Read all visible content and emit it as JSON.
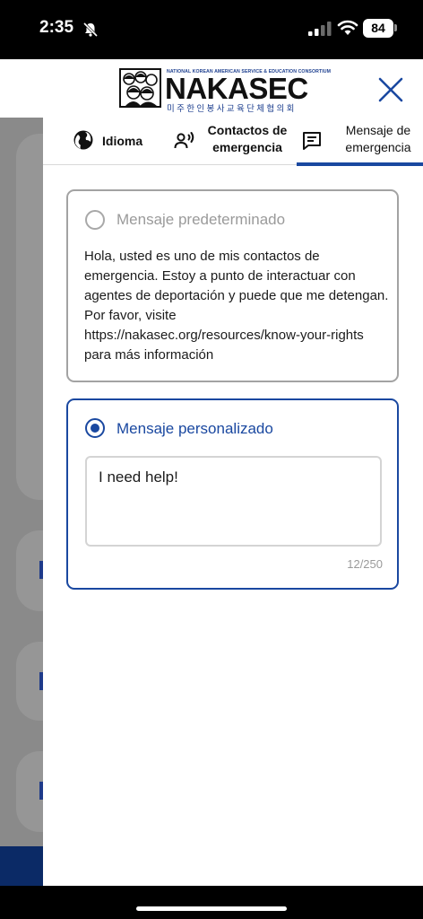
{
  "status_bar": {
    "time": "2:35",
    "battery": "84",
    "icons": [
      "bell-slash-icon",
      "cellular-signal-icon",
      "wifi-icon",
      "battery-icon"
    ]
  },
  "header": {
    "logo": {
      "tagline": "NATIONAL KOREAN AMERICAN SERVICE & EDUCATION CONSORTIUM",
      "name": "NAKASEC",
      "korean": "미주한인봉사교육단체협의회"
    },
    "close_icon": "close-icon"
  },
  "tabs": [
    {
      "label": "Idioma",
      "icon": "globe-icon",
      "active": false
    },
    {
      "label": "Contactos de emergencia",
      "icon": "person-voice-icon",
      "active": false
    },
    {
      "label": "Mensaje de emergencia",
      "icon": "message-icon",
      "active": true
    }
  ],
  "options": {
    "default": {
      "title": "Mensaje predeterminado",
      "selected": false,
      "text": "Hola, usted es uno de mis contactos de emergencia. Estoy a punto de interactuar con agentes de deportación y puede que me detengan. Por favor, visite https://nakasec.org/resources/know-your-rights para más información"
    },
    "custom": {
      "title": "Mensaje personalizado",
      "selected": true,
      "value": "I need help!",
      "counter": "12/250"
    }
  },
  "colors": {
    "accent": "#1a48a0",
    "muted": "#9a9a9a",
    "border_inactive": "#a3a3a3"
  }
}
